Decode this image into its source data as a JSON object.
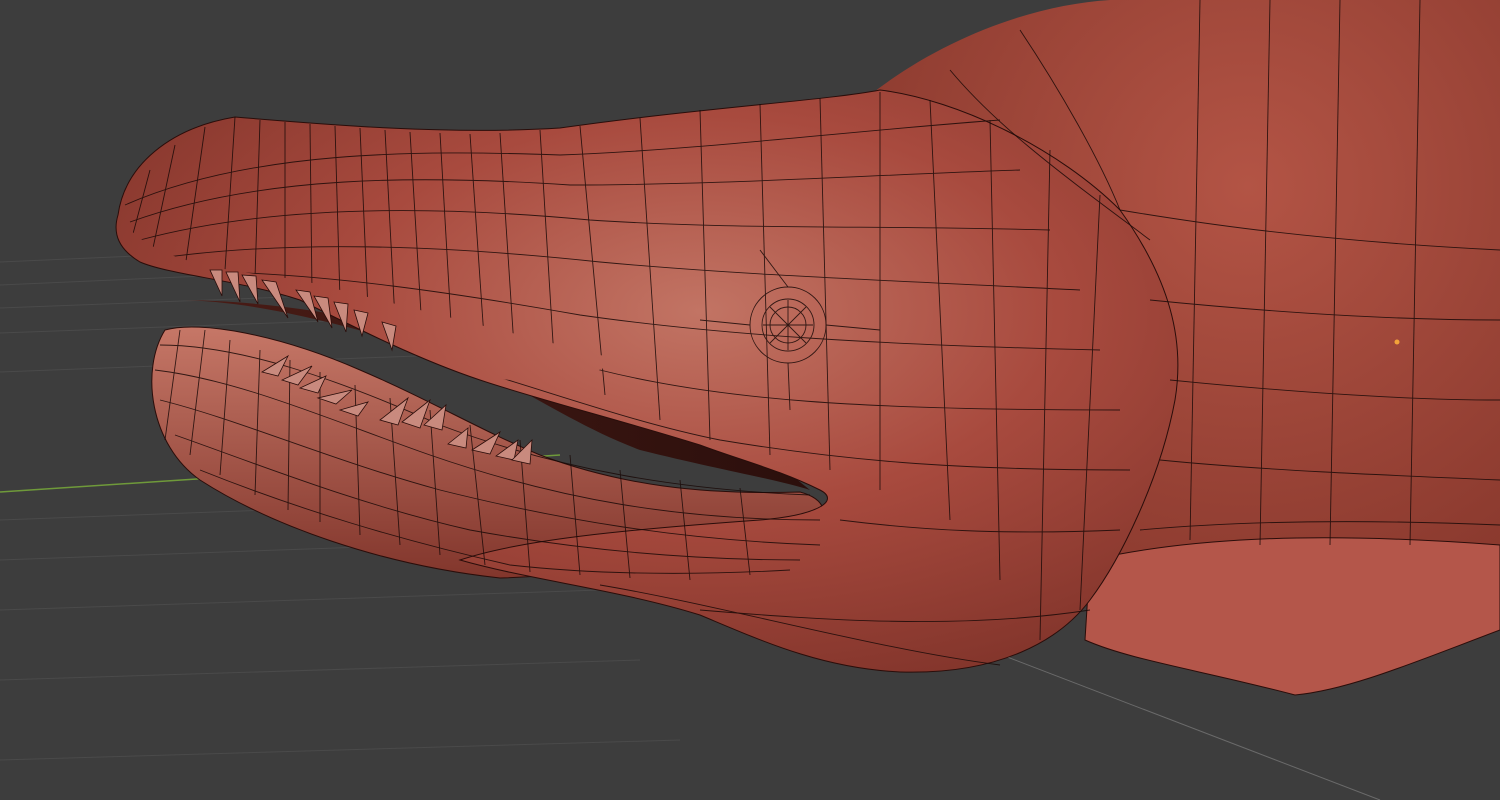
{
  "viewport": {
    "background_color": "#3d3d3d",
    "grid_line_color": "#4a4a4a",
    "x_axis_color": "#6f9a3a",
    "y_axis_color": "#6a6a6a",
    "mesh": {
      "name_hint": "creature-head-mesh",
      "base_color": "#a5493d",
      "light_color": "#c07060",
      "shadow_color": "#6d2a22",
      "wire_color": "#1a0a08",
      "tooth_color": "#c98a7e"
    },
    "origin_dot_color": "#f2a33a"
  }
}
